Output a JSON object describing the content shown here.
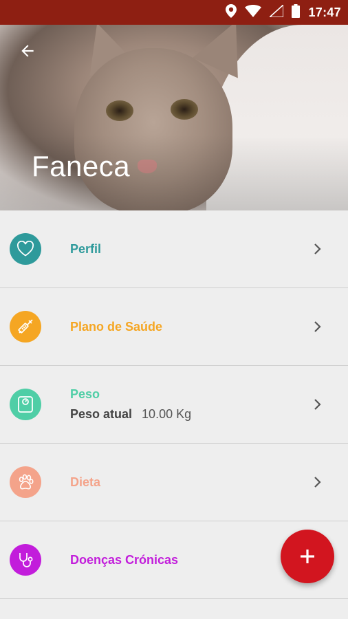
{
  "status_bar": {
    "time": "17:47",
    "icons": [
      "location-icon",
      "wifi-icon",
      "signal-icon",
      "battery-icon"
    ]
  },
  "header": {
    "pet_name": "Faneca",
    "back_icon": "arrow-back-icon"
  },
  "items": [
    {
      "label": "Perfil",
      "color": "#2e9a9b",
      "icon": "heart-icon"
    },
    {
      "label": "Plano de Saúde",
      "color": "#f5a623",
      "icon": "syringe-icon"
    },
    {
      "label": "Peso",
      "color": "#4fcea6",
      "icon": "scale-icon",
      "sub_label": "Peso atual",
      "sub_value": "10.00 Kg"
    },
    {
      "label": "Dieta",
      "color": "#f4a38a",
      "icon": "paw-icon"
    },
    {
      "label": "Doenças Crónicas",
      "color": "#c21ddb",
      "icon": "stethoscope-icon"
    }
  ],
  "fab": {
    "icon": "plus-icon",
    "color": "#d2151f"
  }
}
